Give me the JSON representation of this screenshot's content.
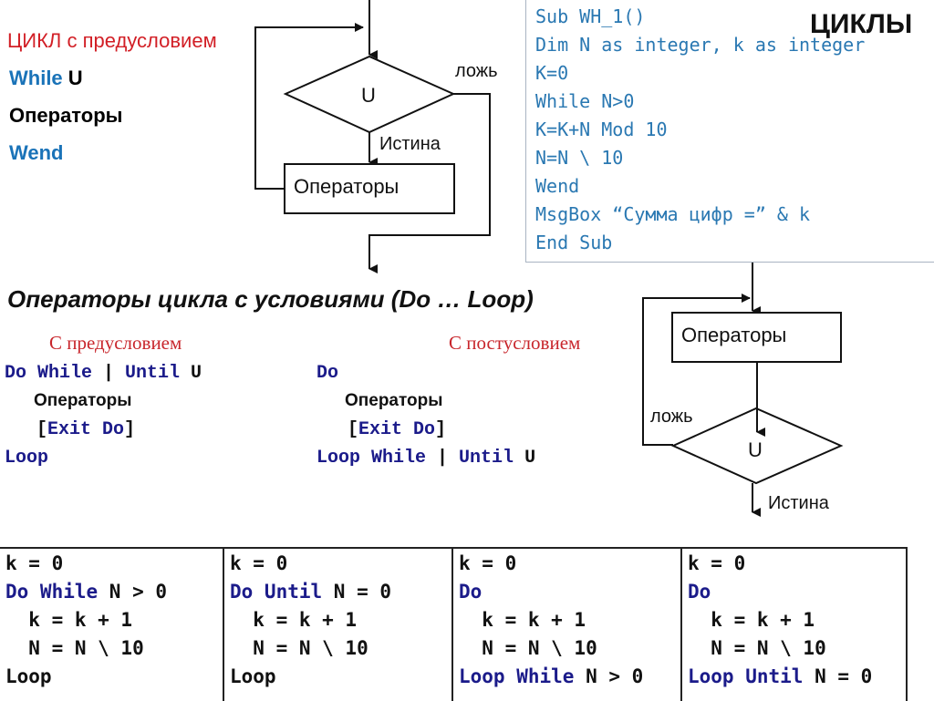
{
  "top_left": {
    "title": "ЦИКЛ с предусловием",
    "while_kw": "While",
    "while_cond": "U",
    "operators": "Операторы",
    "wend": "Wend"
  },
  "flowchart_pre": {
    "condition": "U",
    "false_label": "ложь",
    "true_label": "Истина",
    "body": "Операторы"
  },
  "code_box": {
    "lines": [
      "Sub WH_1()",
      "Dim N as integer, k as integer",
      "K=0",
      "While N>0",
      "K=K+N Mod 10",
      "N=N \\ 10",
      "Wend",
      "MsgBox “Сумма цифр =” & k",
      "End Sub"
    ],
    "title": "ЦИКЛЫ"
  },
  "section": {
    "title": "Операторы цикла с условиями (Do … Loop)",
    "pre": {
      "label": "С предусловием",
      "line1_kw1": "Do While",
      "line1_sep": " | ",
      "line1_kw2": "Until",
      "line1_cond": " U",
      "operators": "Операторы",
      "exit_open": "[",
      "exit": "Exit Do",
      "exit_close": "]",
      "end": "Loop"
    },
    "post": {
      "label": "С постусловием",
      "start": "Do",
      "operators": "Операторы",
      "exit_open": "[",
      "exit": "Exit Do",
      "exit_close": "]",
      "end_kw1": "Loop While",
      "end_sep": " | ",
      "end_kw2": "Until",
      "end_cond": " U"
    }
  },
  "flowchart_post": {
    "body": "Операторы",
    "condition": "U",
    "false_label": "ложь",
    "true_label": "Истина"
  },
  "examples": [
    {
      "init": "k = 0",
      "head_kw": "Do While",
      "head_rest": " N > 0",
      "body1": "  k = k + 1",
      "body2": "  N = N \\ 10",
      "tail_kw": "Loop",
      "tail_rest": ""
    },
    {
      "init": "k = 0",
      "head_kw": "Do Until",
      "head_rest": " N = 0",
      "body1": "  k = k + 1",
      "body2": "  N = N \\ 10",
      "tail_kw": "Loop",
      "tail_rest": ""
    },
    {
      "init": "k = 0",
      "head_kw": "Do",
      "head_rest": "",
      "body1": "  k = k + 1",
      "body2": "  N = N \\ 10",
      "tail_kw": "Loop While",
      "tail_rest": " N > 0"
    },
    {
      "init": "k = 0",
      "head_kw": "Do",
      "head_rest": "",
      "body1": "  k = k + 1",
      "body2": "  N = N \\ 10",
      "tail_kw": "Loop Until",
      "tail_rest": " N = 0"
    }
  ],
  "colors": {
    "title_red": "#d21f26",
    "keyword_blue": "#1a73b8",
    "code_blue": "#2a78b2",
    "vba_keyword_navy": "#1b1b8a",
    "subtitle_red": "#c8262c"
  }
}
